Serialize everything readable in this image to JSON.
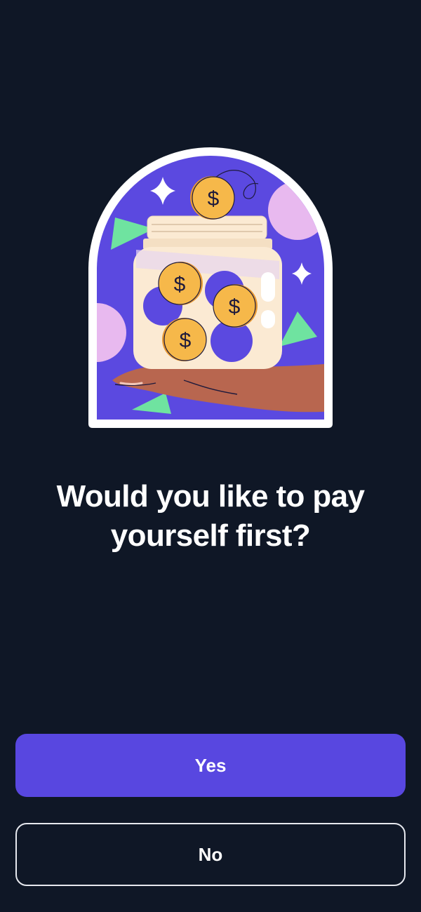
{
  "onboarding": {
    "question": "Would you like to pay yourself first?",
    "illustration_icon": "coin-jar-icon"
  },
  "actions": {
    "yes_label": "Yes",
    "no_label": "No"
  },
  "coins": {
    "symbol": "$"
  },
  "colors": {
    "background": "#0f1726",
    "primary": "#5847e0",
    "illustration_bg": "#5b49e0",
    "coin": "#f6b84a",
    "jar": "#fbead3",
    "accent_green": "#6fe3a0",
    "accent_pink": "#e8b9ef"
  }
}
